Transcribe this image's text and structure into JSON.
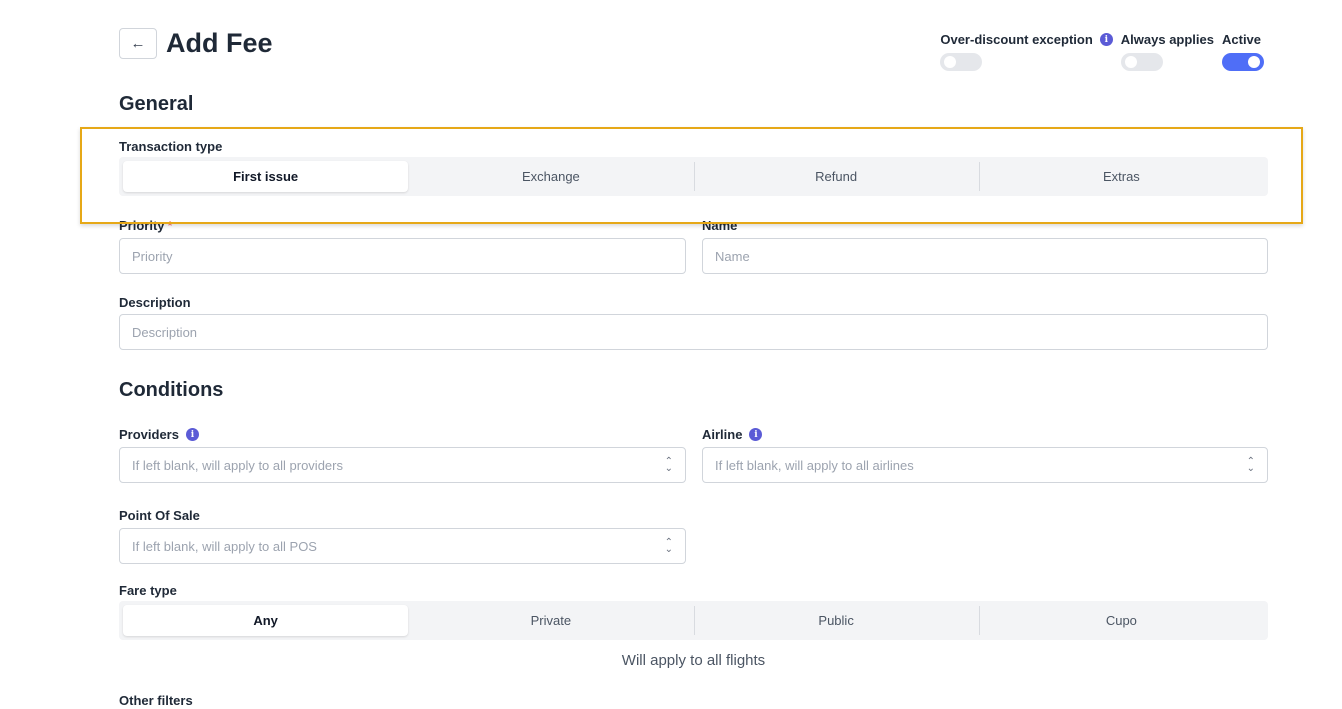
{
  "header": {
    "back_icon": "arrow-left-icon",
    "title": "Add Fee"
  },
  "toggles": {
    "over_discount": {
      "label": "Over-discount exception",
      "on": false
    },
    "always_applies": {
      "label": "Always applies",
      "on": false
    },
    "active": {
      "label": "Active",
      "on": true
    }
  },
  "general": {
    "title": "General",
    "transaction_type": {
      "label": "Transaction type",
      "options": [
        "First issue",
        "Exchange",
        "Refund",
        "Extras"
      ],
      "selected": "First issue"
    },
    "priority": {
      "label": "Priority",
      "required_mark": "*",
      "placeholder": "Priority"
    },
    "name": {
      "label": "Name",
      "placeholder": "Name"
    },
    "description": {
      "label": "Description",
      "placeholder": "Description"
    }
  },
  "conditions": {
    "title": "Conditions",
    "providers": {
      "label": "Providers",
      "placeholder": "If left blank, will apply to all providers"
    },
    "airline": {
      "label": "Airline",
      "placeholder": "If left blank, will apply to all airlines"
    },
    "pos": {
      "label": "Point Of Sale",
      "placeholder": "If left blank, will apply to all POS"
    },
    "fare_type": {
      "label": "Fare type",
      "options": [
        "Any",
        "Private",
        "Public",
        "Cupo"
      ],
      "selected": "Any"
    },
    "apply_note": "Will apply to all flights",
    "other_filters": "Other filters"
  },
  "colors": {
    "accent": "#4f6ef7",
    "highlight": "#e6a817",
    "info": "#5b5bd6"
  }
}
